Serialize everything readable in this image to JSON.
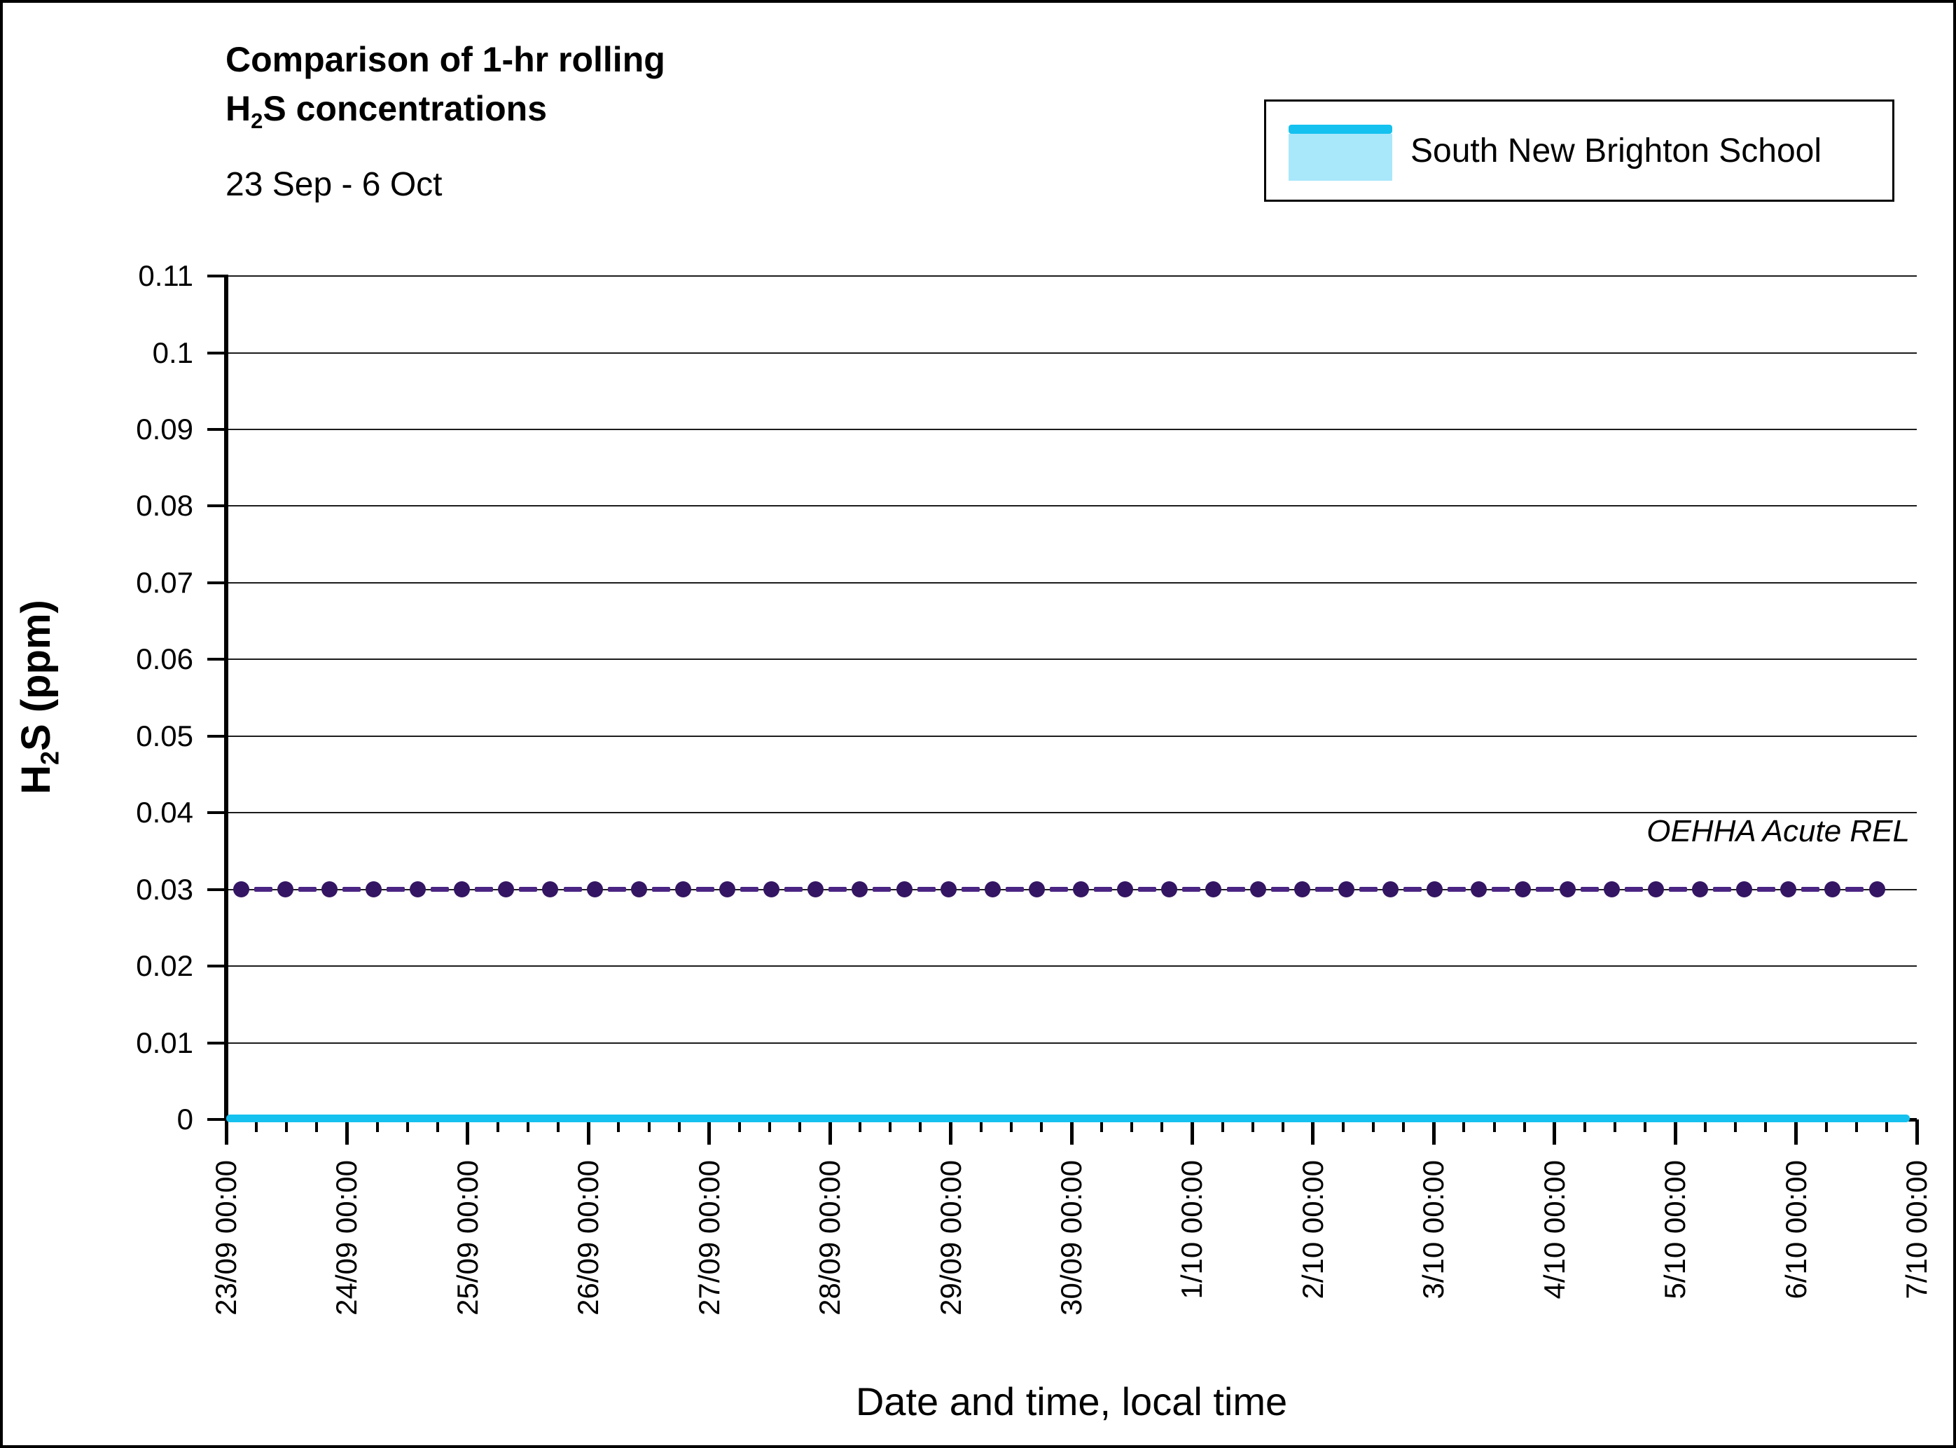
{
  "header": {
    "title_line1": "Comparison of 1-hr rolling",
    "title_line2_base": "H",
    "title_line2_sub": "2",
    "title_line2_rest": "S concentrations",
    "subtitle": "23 Sep - 6 Oct"
  },
  "legend": {
    "label": "South New Brighton School"
  },
  "y_axis": {
    "title_base": "H",
    "title_sub": "2",
    "title_rest": "S (ppm)"
  },
  "x_axis": {
    "title": "Date and time, local time"
  },
  "annotation": {
    "label": "OEHHA Acute REL"
  },
  "chart_data": {
    "type": "line",
    "title": "Comparison of 1-hr rolling H2S concentrations",
    "subtitle": "23 Sep - 6 Oct",
    "xlabel": "Date and time, local time",
    "ylabel": "H2S (ppm)",
    "ylim": [
      0,
      0.11
    ],
    "ytick_step": 0.01,
    "ytick_labels": [
      "0",
      "0.01",
      "0.02",
      "0.03",
      "0.04",
      "0.05",
      "0.06",
      "0.07",
      "0.08",
      "0.09",
      "0.1",
      "0.11"
    ],
    "xtick_labels": [
      "23/09 00:00",
      "24/09 00:00",
      "25/09 00:00",
      "26/09 00:00",
      "27/09 00:00",
      "28/09 00:00",
      "29/09 00:00",
      "30/09 00:00",
      "1/10 00:00",
      "2/10 00:00",
      "3/10 00:00",
      "4/10 00:00",
      "5/10 00:00",
      "6/10 00:00",
      "7/10 00:00"
    ],
    "minor_xticks_between_days": 3,
    "grid": "horizontal",
    "legend_position": "top-right",
    "series": [
      {
        "name": "South New Brighton School",
        "line_color": "#15C1EE",
        "legend_fill_color": "#A9E7FB",
        "constant_value_ppm": 0,
        "x_start": "23/09 00:00",
        "x_end": "6/10 late"
      }
    ],
    "reference_lines": [
      {
        "name": "OEHHA Acute REL",
        "value_ppm": 0.03,
        "style": "dashed with circular markers",
        "marker_color": "#341563",
        "dash_color": "#4B2583",
        "marker_count": 38
      }
    ]
  }
}
